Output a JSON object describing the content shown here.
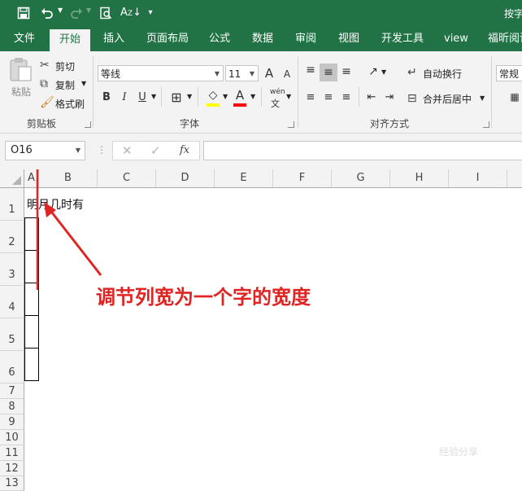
{
  "quick_access": {
    "save_icon": "save-icon",
    "undo_icon": "undo-icon",
    "redo_icon": "redo-icon",
    "print_preview_icon": "print-preview-icon",
    "sort_icon": "sort-icon",
    "customize_icon": "customize-icon",
    "title_right": "按字"
  },
  "tabs": [
    "文件",
    "开始",
    "插入",
    "页面布局",
    "公式",
    "数据",
    "审阅",
    "视图",
    "开发工具",
    "view",
    "福昕阅读"
  ],
  "active_tab": "开始",
  "clipboard": {
    "paste": "粘贴",
    "cut": "剪切",
    "copy": "复制",
    "format_painter": "格式刷",
    "group_label": "剪贴板"
  },
  "font": {
    "name": "等线",
    "size": "11",
    "bold": "B",
    "italic": "I",
    "underline": "U",
    "grow": "A",
    "shrink": "A",
    "phonetic": "wén",
    "group_label": "字体",
    "fill_color": "#ffff00",
    "font_color": "#ff0000"
  },
  "alignment": {
    "wrap_text": "自动换行",
    "merge_center": "合并后居中",
    "group_label": "对齐方式"
  },
  "number": {
    "format": "常规"
  },
  "formula_bar": {
    "name_box": "O16",
    "cancel": "✕",
    "enter": "✓",
    "fx": "fx",
    "formula": ""
  },
  "sheet": {
    "columns": [
      "A",
      "B",
      "C",
      "D",
      "E",
      "F",
      "G",
      "H",
      "I"
    ],
    "rows": [
      "1",
      "2",
      "3",
      "4",
      "5",
      "6",
      "7",
      "8",
      "9",
      "10",
      "11",
      "12",
      "13"
    ],
    "cell_A1": "明月几时有"
  },
  "annotation": {
    "text": "调节列宽为一个字的宽度",
    "color": "#e02424"
  },
  "watermark": "经验分享"
}
